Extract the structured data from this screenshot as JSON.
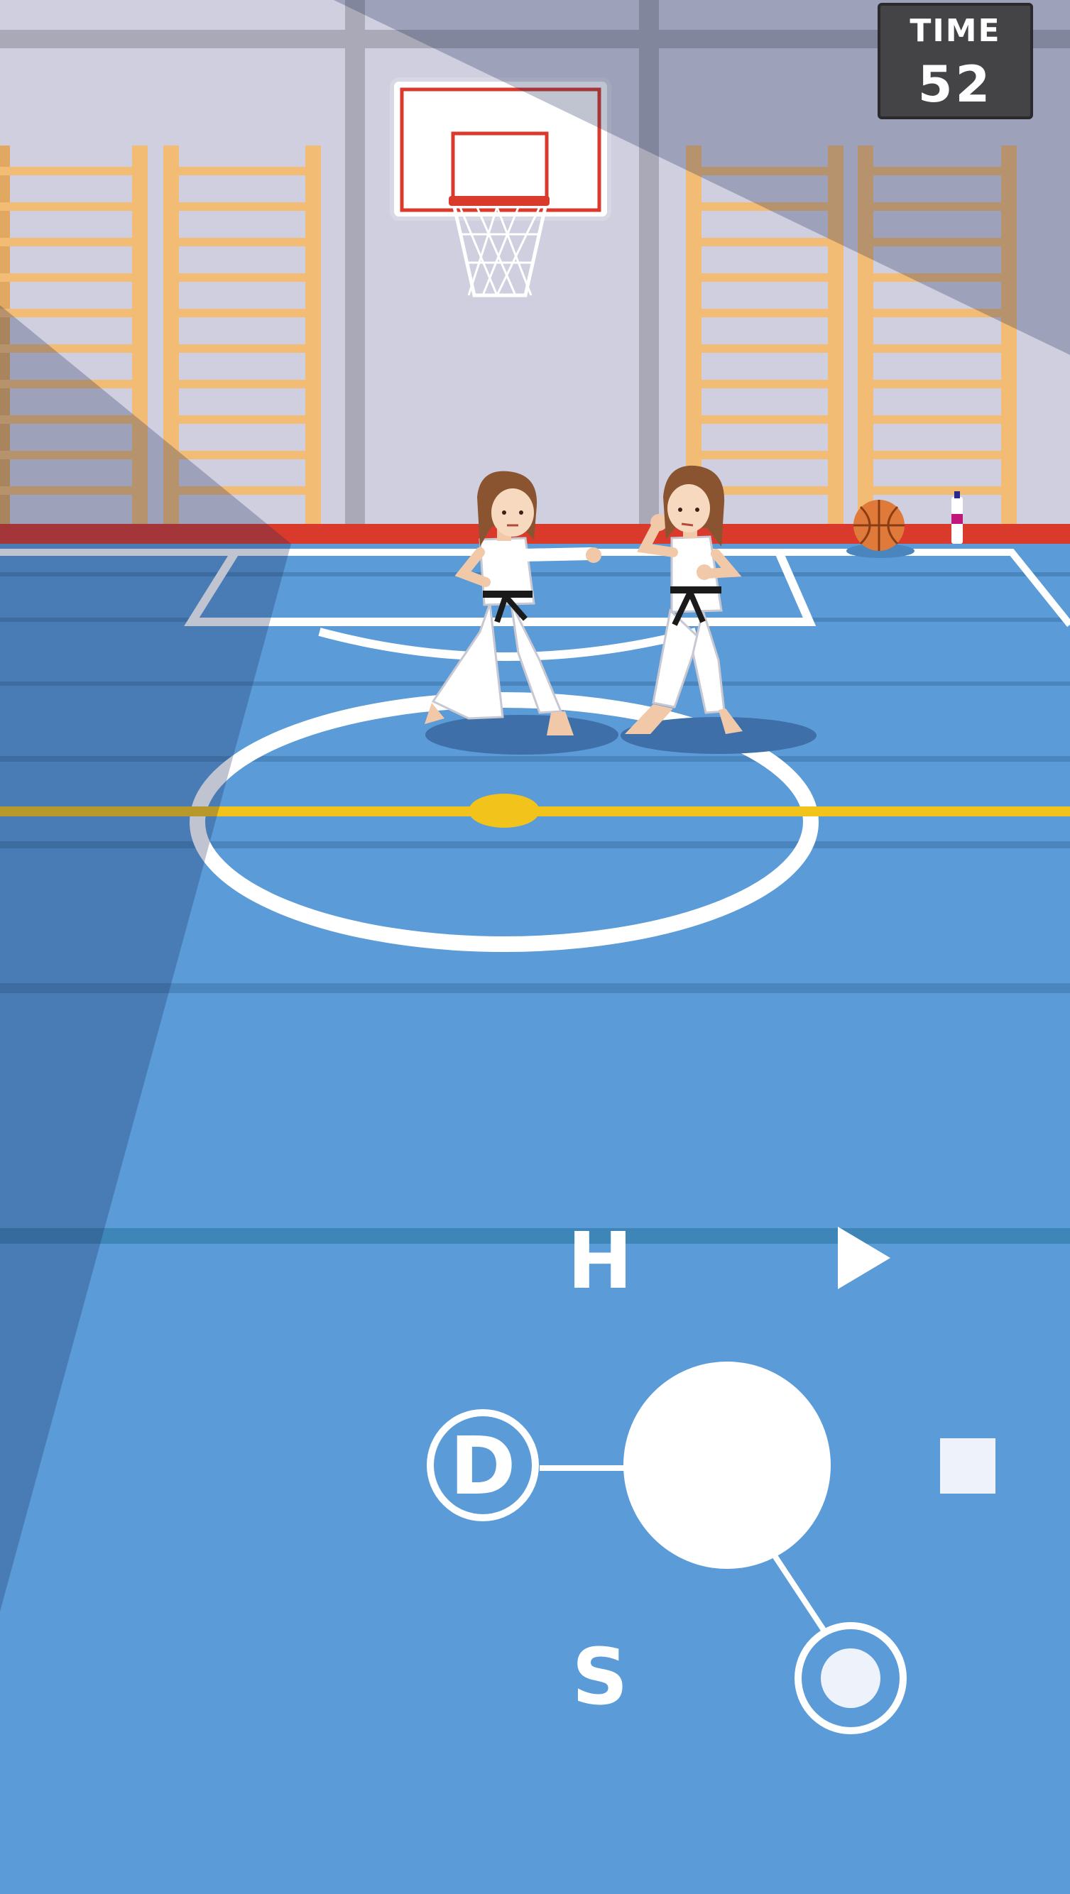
{
  "hud": {
    "time_label": "TIME",
    "time_value": "52"
  },
  "controls": {
    "top_left_label": "H",
    "left_label": "D",
    "bottom_left_label": "S",
    "top_right_icon": "play-icon",
    "right_icon": "stop-icon",
    "bottom_right_icon": "circle-target-icon"
  },
  "colors": {
    "court_blue": "#5a9bd8",
    "center_line": "#f2c31a",
    "wall": "#cfcfe0",
    "floor_edge": "#d93a2b",
    "ladder": "#f2bc74"
  }
}
